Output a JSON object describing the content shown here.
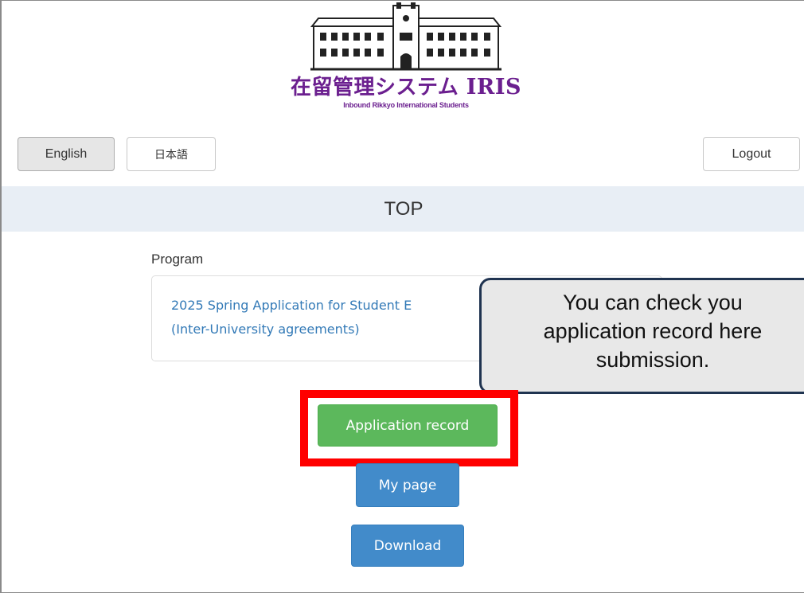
{
  "logo": {
    "title_jp": "在留管理システム",
    "title_latin": "IRIS",
    "subtitle": "Inbound Rikkyo International Students"
  },
  "header": {
    "english_label": "English",
    "japanese_label": "日本語",
    "logout_label": "Logout"
  },
  "page": {
    "title": "TOP"
  },
  "program": {
    "label": "Program",
    "link_text": "2025 Spring Application for Student E",
    "link_text_line2": "(Inter-University agreements)"
  },
  "callout": {
    "line1": "You can check you",
    "line2": "application record here",
    "line3": "submission."
  },
  "actions": {
    "application_record_label": "Application record",
    "mypage_label": "My page",
    "download_label": "Download"
  },
  "colors": {
    "brand_purple": "#6b1f8f",
    "success_green": "#5cb85c",
    "primary_blue": "#428bca",
    "link_blue": "#337ab7",
    "highlight_red": "#ff0000",
    "title_bar_bg": "#e8eef5"
  }
}
